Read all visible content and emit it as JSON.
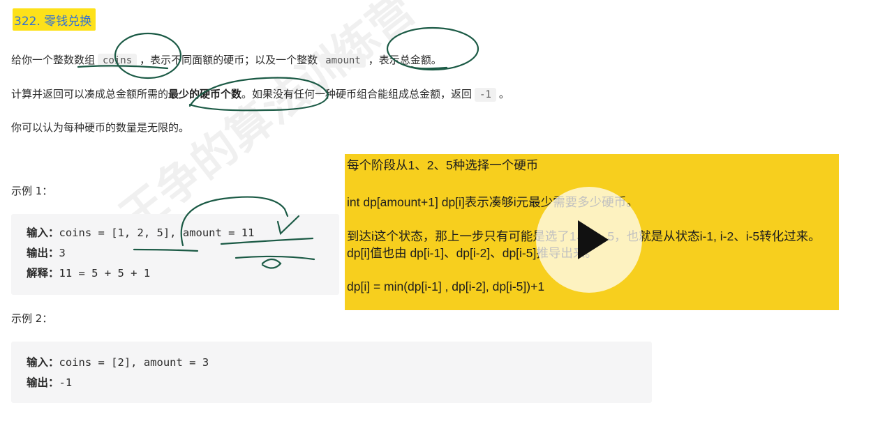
{
  "problem": {
    "title": "322. 零钱兑换",
    "desc1": {
      "pre": "给你一个整数数组",
      "code1": "coins",
      "mid": "，表示不同面额的硬币；以及一个整数",
      "code2": "amount",
      "post": "，表示总金额。"
    },
    "desc2": {
      "pre": "计算并返回可以凑成总金额所需的",
      "bold": "最少的硬币个数",
      "mid": "。如果没有任何一种硬币组合能组成总金额，返回",
      "code": "-1",
      "post": "。"
    },
    "desc3": "你可以认为每种硬币的数量是无限的。"
  },
  "example1": {
    "label": "示例 1：",
    "input_label": "输入：",
    "input": "coins = [1, 2, 5], amount = 11",
    "output_label": "输出：",
    "output": "3",
    "explain_label": "解释：",
    "explain": "11 = 5 + 5 + 1"
  },
  "example2": {
    "label": "示例 2：",
    "input_label": "输入：",
    "input": "coins = [2], amount = 3",
    "output_label": "输出：",
    "output": "-1"
  },
  "note": {
    "line1": "每个阶段从1、2、5种选择一个硬币",
    "line2": "int dp[amount+1]  dp[i]表示凑够i元最少需要多少硬币。",
    "line3": "到达i这个状态，那上一步只有可能是选了1、2、5，也就是从状态i-1, i-2、i-5转化过来。dp[i]值也由 dp[i-1]、dp[i-2]、dp[i-5]推导出来。",
    "line4": "dp[i] = min(dp[i-1] , dp[i-2], dp[i-5])+1"
  },
  "watermark": "王争的算法训练营",
  "colors": {
    "title_bg": "#fde11a",
    "title_text": "#2f6fd6",
    "note_bg": "#f7cf1e",
    "ink": "#1b5a45"
  },
  "icons": {
    "play": "play-icon"
  }
}
